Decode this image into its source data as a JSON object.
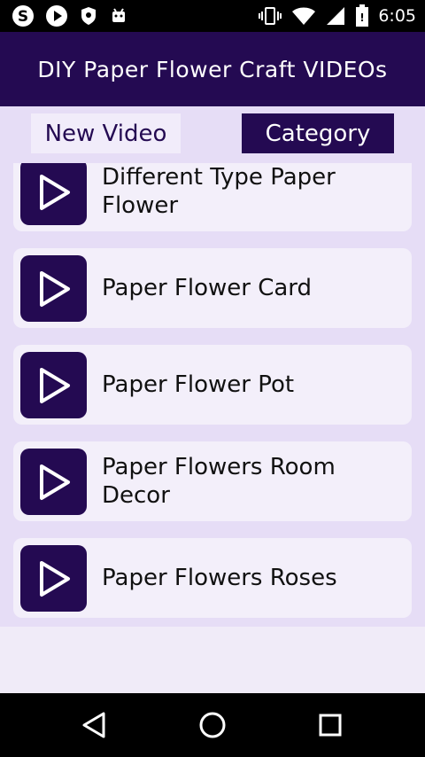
{
  "status_bar": {
    "time": "6:05",
    "left_icons": [
      "skype-icon",
      "play-icon",
      "shield-icon",
      "android-icon"
    ],
    "right_icons": [
      "vibrate-icon",
      "wifi-icon",
      "signal-icon",
      "battery-icon"
    ]
  },
  "app_bar": {
    "title": "DIY Paper Flower Craft VIDEOs"
  },
  "tabs": [
    {
      "label": "New Video",
      "selected": false
    },
    {
      "label": "Category",
      "selected": true
    }
  ],
  "videos": [
    {
      "title": "Different Type Paper Flower"
    },
    {
      "title": "Paper Flower Card"
    },
    {
      "title": "Paper Flower Pot"
    },
    {
      "title": "Paper Flowers Room Decor"
    },
    {
      "title": "Paper Flowers Roses"
    }
  ],
  "colors": {
    "primary": "#240a52",
    "list_background": "#e6ddf6",
    "card_background": "#f3effa"
  }
}
